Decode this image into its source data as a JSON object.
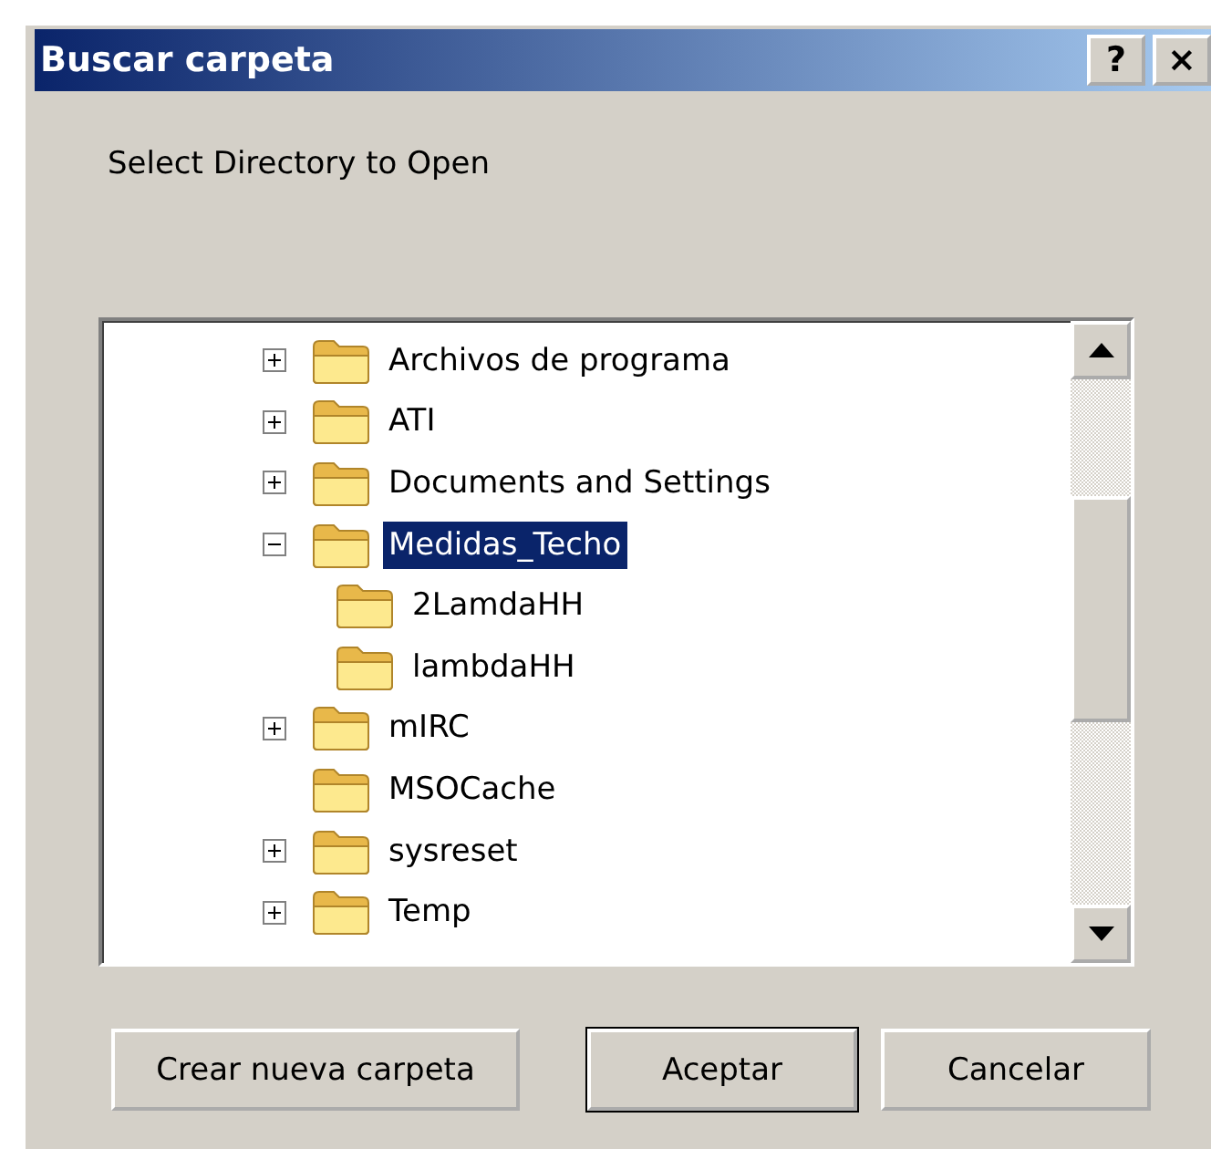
{
  "window": {
    "title": "Buscar carpeta",
    "title_buttons": [
      "?",
      "×"
    ]
  },
  "prompt": "Select Directory to Open",
  "tree": [
    {
      "label": "Archivos de programa",
      "expandable": true,
      "expanded": false,
      "selected": false
    },
    {
      "label": "ATI",
      "expandable": true,
      "expanded": false,
      "selected": false
    },
    {
      "label": "Documents and Settings",
      "expandable": true,
      "expanded": false,
      "selected": false
    },
    {
      "label": "Medidas_Techo",
      "expandable": true,
      "expanded": true,
      "selected": true,
      "children": [
        {
          "label": "2LamdaHH",
          "expandable": false,
          "expanded": false,
          "selected": false
        },
        {
          "label": "lambdaHH",
          "expandable": false,
          "expanded": false,
          "selected": false
        }
      ]
    },
    {
      "label": "mIRC",
      "expandable": true,
      "expanded": false,
      "selected": false
    },
    {
      "label": "MSOCache",
      "expandable": false,
      "expanded": false,
      "selected": false
    },
    {
      "label": "sysreset",
      "expandable": true,
      "expanded": false,
      "selected": false
    },
    {
      "label": "Temp",
      "expandable": true,
      "expanded": false,
      "selected": false
    }
  ],
  "buttons": [
    {
      "label": "Crear nueva carpeta",
      "default": false
    },
    {
      "label": "Aceptar",
      "default": true
    },
    {
      "label": "Cancelar",
      "default": false
    }
  ]
}
